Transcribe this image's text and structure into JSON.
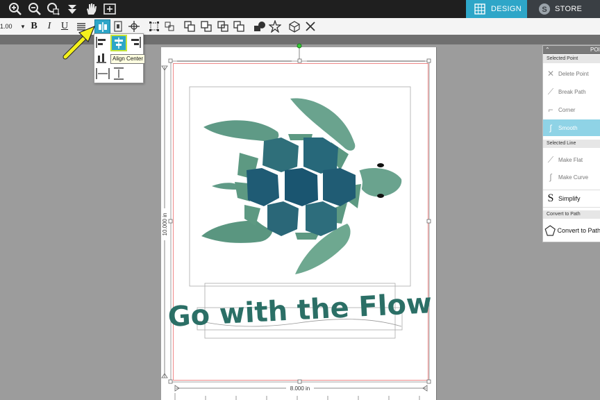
{
  "top_bar": {
    "tools": [
      "zoom-in",
      "zoom-out",
      "zoom-fit",
      "pan-down",
      "hand",
      "zoom-page"
    ],
    "design_tab": "DESIGN",
    "store_tab": "STORE",
    "accent": "#2ea6c8"
  },
  "toolbar": {
    "line_weight": "1.00",
    "bold": "B",
    "italic": "I",
    "underline": "U"
  },
  "align_menu": {
    "tooltip": "Align Center"
  },
  "design": {
    "text": "Go with the Flow",
    "text_color": "#2b6f66",
    "height_label": "10.000 in",
    "width_label": "8.000 in"
  },
  "points_panel": {
    "header": "POI",
    "selected_point": "Selected Point",
    "delete_point": "Delete Point",
    "break_path": "Break Path",
    "corner": "Corner",
    "smooth": "Smooth",
    "selected_line": "Selected Line",
    "make_flat": "Make Flat",
    "make_curve": "Make Curve",
    "simplify": "Simplify",
    "convert_section": "Convert to Path",
    "convert_button": "Convert to Path"
  }
}
